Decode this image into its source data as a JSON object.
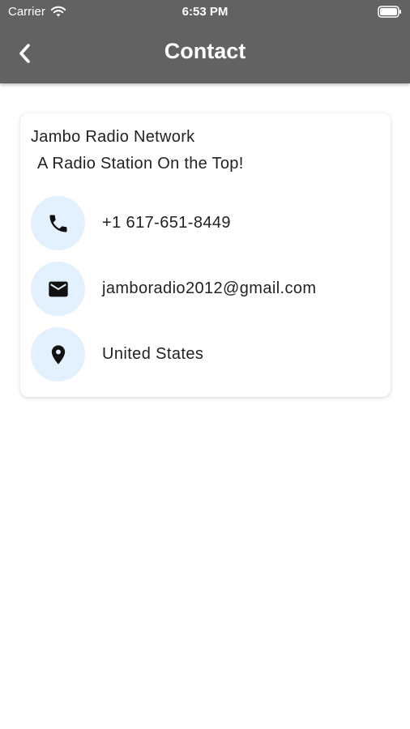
{
  "status_bar": {
    "carrier": "Carrier",
    "time": "6:53 PM"
  },
  "nav": {
    "title": "Contact",
    "back_icon": "chevron-left-icon"
  },
  "contact_card": {
    "name": "Jambo Radio Network",
    "tagline": "A Radio Station On the Top!",
    "items": [
      {
        "icon": "phone-icon",
        "text": "+1 617-651-8449"
      },
      {
        "icon": "mail-icon",
        "text": "jamboradio2012@gmail.com"
      },
      {
        "icon": "location-pin-icon",
        "text": "United States"
      }
    ]
  },
  "colors": {
    "app_bar": "#626262",
    "icon_circle": "#e3f0fd",
    "text": "#222222",
    "background": "#ffffff"
  }
}
